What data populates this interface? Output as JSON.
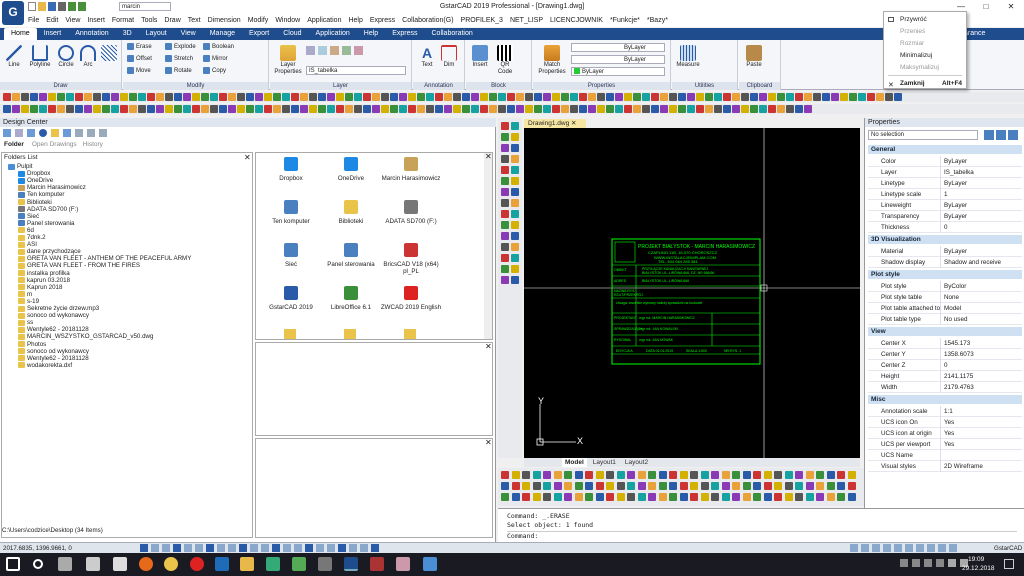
{
  "window": {
    "title": "GstarCAD 2019 Professional - [Drawing1.dwg]",
    "search_value": "marcin",
    "minimize_label": "—",
    "maximize_label": "□",
    "close_label": "✕"
  },
  "menu": [
    "File",
    "Edit",
    "View",
    "Insert",
    "Format",
    "Tools",
    "Draw",
    "Text",
    "Dimension",
    "Modify",
    "Window",
    "Application",
    "Help",
    "Express",
    "Collaboration(G)",
    "PROFILEK_3",
    "NET_LISP",
    "LICENCJOWNIK",
    "*Funkcje*",
    "*Bazy*"
  ],
  "ribbon_tabs": [
    "Home",
    "Insert",
    "Annotation",
    "3D",
    "Layout",
    "View",
    "Manage",
    "Export",
    "Cloud",
    "Application",
    "Help",
    "Express",
    "Collaboration"
  ],
  "ribbon_tab_extra": "arance",
  "ribbon": {
    "draw": {
      "label": "Draw",
      "buttons": [
        "Line",
        "Polyline",
        "Circle",
        "Arc"
      ]
    },
    "modify": {
      "label": "Modify",
      "buttons": [
        "Erase",
        "Explode",
        "Boolean",
        "Offset",
        "Stretch",
        "Mirror",
        "Move",
        "Rotate",
        "Copy"
      ]
    },
    "layer": {
      "label": "Layer",
      "properties": "Layer Properties",
      "current": "IS_tabelka"
    },
    "annotation": {
      "label": "Annotation",
      "buttons": [
        "Text",
        "Dim"
      ]
    },
    "block": {
      "label": "Block",
      "buttons": [
        "Insert",
        "QR Code"
      ]
    },
    "properties": {
      "label": "Properties",
      "match": "Match Properties",
      "bylayer": [
        "ByLayer",
        "ByLayer",
        "ByLayer"
      ]
    },
    "utilities": {
      "label": "Utilities",
      "buttons": [
        "Measure"
      ]
    },
    "clipboard": {
      "label": "Clipboard",
      "buttons": [
        "Paste"
      ]
    }
  },
  "design_center": {
    "title": "Design Center",
    "tabs": [
      "Folder",
      "Open Drawings",
      "History"
    ],
    "folders_label": "Folders List",
    "tree": [
      "Pulpit",
      "Dropbox",
      "OneDrive",
      "Marcin Harasimowicz",
      "Ten komputer",
      "Biblioteki",
      "ADATA SD700 (F:)",
      "Sieć",
      "Panel sterowania",
      "6d",
      "7dnk.2",
      "ASI",
      "dane przychodzące",
      "GRETA VAN FLEET - ANTHEM OF THE PEACEFUL ARMY",
      "GRETA VAN FLEET - FROM THE FIRES",
      "instalka profilka",
      "kaprun 03.2018",
      "Kaprun 2018",
      "m",
      "s-19",
      "Sekretne życie drzew.mp3",
      "sonoco od wykonawcy",
      "ss",
      "Wentyle62 - 20181128",
      "MARCIN_WSZYSTKO_GSTARCAD_v50.dwg",
      "Photos",
      "sonoco od wykonawcy",
      "Wentyle62 - 20181128",
      "wodakorekta.dxf"
    ],
    "icons": [
      "Dropbox",
      "OneDrive",
      "Marcin Harasimowicz",
      "Ten komputer",
      "Biblioteki",
      "ADATA SD700 (F:)",
      "Sieć",
      "Panel sterowania",
      "BricsCAD V18 (x64) pl_PL",
      "GstarCAD 2019",
      "LibreOffice 6.1",
      "ZWCAD 2019 English"
    ],
    "status": "C:\\Users\\codzice\\Desktop  (34  Items)"
  },
  "drawing": {
    "tab": "Drawing1.dwg",
    "layout_tabs": [
      "Model",
      "Layout1",
      "Layout2"
    ],
    "axis_x": "X",
    "axis_y": "Y",
    "titleblock": {
      "header": "PROJEKT BIAŁYSTOK - MARCIN HARASIMOWICZ",
      "address": "CZAPLINO 11B, 16-070 CHOROSZCZ",
      "web": "WWW.INSTALACJEIMPLAM.COM",
      "phone": "TEL. 604 664 285 384",
      "obiekt_label": "OBIEKT",
      "obiekt": "PRZYŁĄCZE KANALIZACJI SANITARNEJ",
      "obiekt2": "BIAŁYSTOK UL. LIRÓWA 666, DZ. NR 666/66",
      "adres_label": "ADRES",
      "adres": "BIAŁYSTOK UL. LIRÓWA 666",
      "nazwa_label": "NAZWA RYS.",
      "nazwa": "RZUT/PRZEKRÓJ",
      "note": "Uwaga: wszelkie wymiary należy sprawdzić na budowie",
      "rows": [
        {
          "label": "PROJEKTANT",
          "value": "mgr inż. MARCIN HARASIMOWICZ"
        },
        {
          "label": "SPRAWDZAJĄCY",
          "value": "mgr inż. JAN KOWALSKI"
        },
        {
          "label": "RYSOWAŁ",
          "value": "mgr inż. JAN NOWAK"
        }
      ],
      "footer": [
        "EDYCJA A",
        "DATA 01.01.2019",
        "SKALA 1:500",
        "NR RYS. 1"
      ]
    }
  },
  "properties": {
    "title": "Properties",
    "selection": "No selection",
    "sections": {
      "general": "General",
      "viz": "3D Visualization",
      "plot": "Plot style",
      "view": "View",
      "misc": "Misc"
    },
    "general": [
      {
        "k": "Color",
        "v": "ByLayer"
      },
      {
        "k": "Layer",
        "v": "IS_tabelka"
      },
      {
        "k": "Linetype",
        "v": "ByLayer"
      },
      {
        "k": "Linetype scale",
        "v": "1"
      },
      {
        "k": "Lineweight",
        "v": "ByLayer"
      },
      {
        "k": "Transparency",
        "v": "ByLayer"
      },
      {
        "k": "Thickness",
        "v": "0"
      }
    ],
    "viz": [
      {
        "k": "Material",
        "v": "ByLayer"
      },
      {
        "k": "Shadow display",
        "v": "Shadow and receive shadow"
      }
    ],
    "plot": [
      {
        "k": "Plot style",
        "v": "ByColor"
      },
      {
        "k": "Plot style table",
        "v": "None"
      },
      {
        "k": "Plot table attached to",
        "v": "Model"
      },
      {
        "k": "Plot table type",
        "v": "No used"
      }
    ],
    "view": [
      {
        "k": "Center X",
        "v": "1545.173"
      },
      {
        "k": "Center Y",
        "v": "1358.6073"
      },
      {
        "k": "Center Z",
        "v": "0"
      },
      {
        "k": "Height",
        "v": "2141.1175"
      },
      {
        "k": "Width",
        "v": "2179.4763"
      }
    ],
    "misc": [
      {
        "k": "Annotation scale",
        "v": "1:1"
      },
      {
        "k": "UCS icon On",
        "v": "Yes"
      },
      {
        "k": "UCS icon at origin",
        "v": "Yes"
      },
      {
        "k": "UCS per viewport",
        "v": "Yes"
      },
      {
        "k": "UCS Name",
        "v": ""
      },
      {
        "k": "Visual styles",
        "v": "2D Wireframe"
      }
    ]
  },
  "context_menu": {
    "items": [
      {
        "label": "Przywróć",
        "disabled": false
      },
      {
        "label": "Przenieś",
        "disabled": true
      },
      {
        "label": "Rozmiar",
        "disabled": true
      },
      {
        "label": "Minimalizuj",
        "disabled": false
      },
      {
        "label": "Maksymalizuj",
        "disabled": true
      },
      {
        "label": "Zamknij",
        "disabled": false,
        "shortcut": "Alt+F4"
      }
    ]
  },
  "command": {
    "line1": "Command: _.ERASE",
    "line2": "Select object:  1 found",
    "prompt": "Command:"
  },
  "status": {
    "coords": "2017.6835, 1396.9661, 0",
    "app": "GstarCAD"
  },
  "taskbar": {
    "time": "19:09",
    "date": "29.12.2018"
  },
  "colors": {
    "ribbon_blue": "#1e4c8c",
    "green": "#00ff00",
    "bylayer_swatch": "#22cc33"
  }
}
